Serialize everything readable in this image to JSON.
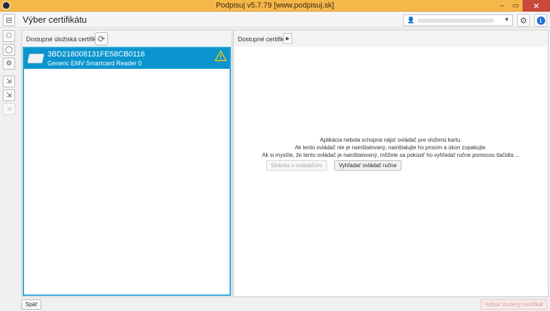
{
  "window": {
    "title": "Podpisuj v5.7.79 [www.podpisuj.sk]",
    "minimize_glyph": "–",
    "maximize_glyph": "▭",
    "close_glyph": "✕"
  },
  "header": {
    "title": "Výber certifikátu",
    "user_select_value": "",
    "icons": [
      "menu-icon",
      "user-icon",
      "settings-icon",
      "info-icon"
    ]
  },
  "side_toolbar": {
    "items": [
      {
        "name": "attachment-tool",
        "glyph": "⎔"
      },
      {
        "name": "comment-tool",
        "glyph": "◯"
      },
      {
        "name": "signature-tool",
        "glyph": "⚙"
      },
      {
        "name": "import-tool-1",
        "glyph": "⇲"
      },
      {
        "name": "import-tool-2",
        "glyph": "⇲"
      },
      {
        "name": "import-tool-3",
        "glyph": "⇲"
      }
    ]
  },
  "left_panel": {
    "label": "Dostupné úložiská certifikátov",
    "stores": [
      {
        "name": "3BD218008131FE58CB0116",
        "reader": "Generic EMV Smartcard Reader 0",
        "status": "warning"
      }
    ]
  },
  "right_panel": {
    "label": "Dostupné certifikáty",
    "message_lines": [
      "Aplikácia nebola schopná nájsť ovládač pre vloženú kartu.",
      "Ak tento ovládač nie je nainštalovaný, nainštalujte ho prosím a úkon zopakujte.",
      "Ak si myslíte, že tento ovládač je nainštalovaný, môžete sa pokúsiť ho vyhľadať ručne pomocou tlačidla ..."
    ],
    "driver_page_button": "Stránka s ovládačom",
    "find_driver_button": "Vyhľadať ovládač ručne"
  },
  "footer": {
    "back_button": "Späť",
    "select_button": "Vybrať zvolený certifikát"
  },
  "colors": {
    "titlebar": "#f6b74a",
    "selection": "#0b95cf",
    "selection_border": "#2fa7da",
    "close_button": "#c8483b",
    "warning": "#f0c419"
  }
}
